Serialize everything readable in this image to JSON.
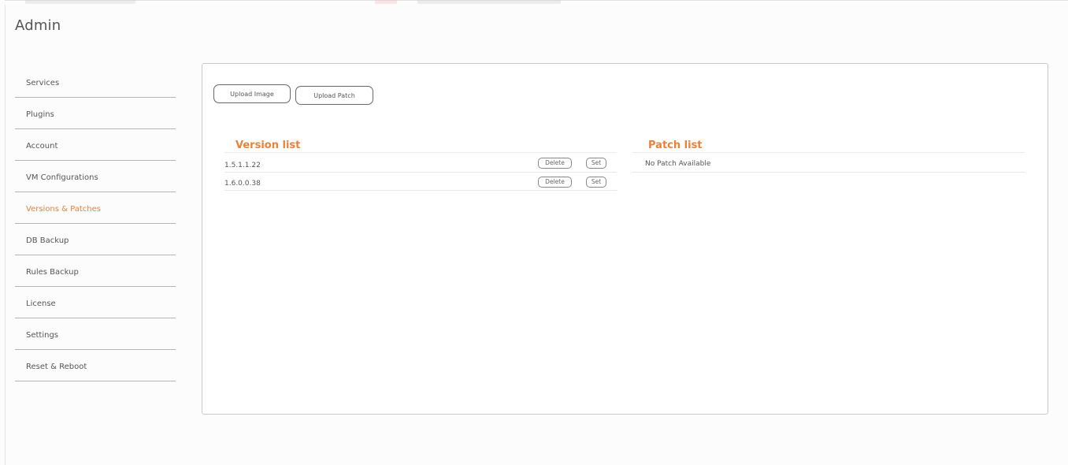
{
  "page": {
    "title": "Admin"
  },
  "sidebar": {
    "items": [
      {
        "label": "Services",
        "active": false
      },
      {
        "label": "Plugins",
        "active": false
      },
      {
        "label": "Account",
        "active": false
      },
      {
        "label": "VM Configurations",
        "active": false
      },
      {
        "label": "Versions & Patches",
        "active": true
      },
      {
        "label": "DB Backup",
        "active": false
      },
      {
        "label": "Rules Backup",
        "active": false
      },
      {
        "label": "License",
        "active": false
      },
      {
        "label": "Settings",
        "active": false
      },
      {
        "label": "Reset & Reboot",
        "active": false
      }
    ]
  },
  "toolbar": {
    "upload_image_label": "Upload Image",
    "upload_patch_label": "Upload Patch"
  },
  "versions": {
    "heading": "Version list",
    "rows": [
      {
        "version": "1.5.1.1.22",
        "delete_label": "Delete",
        "set_label": "Set"
      },
      {
        "version": "1.6.0.0.38",
        "delete_label": "Delete",
        "set_label": "Set"
      }
    ]
  },
  "patches": {
    "heading": "Patch list",
    "empty_text": "No Patch Available"
  },
  "colors": {
    "accent": "#e8823b",
    "text": "#555555",
    "divider": "#b5b5b5"
  }
}
